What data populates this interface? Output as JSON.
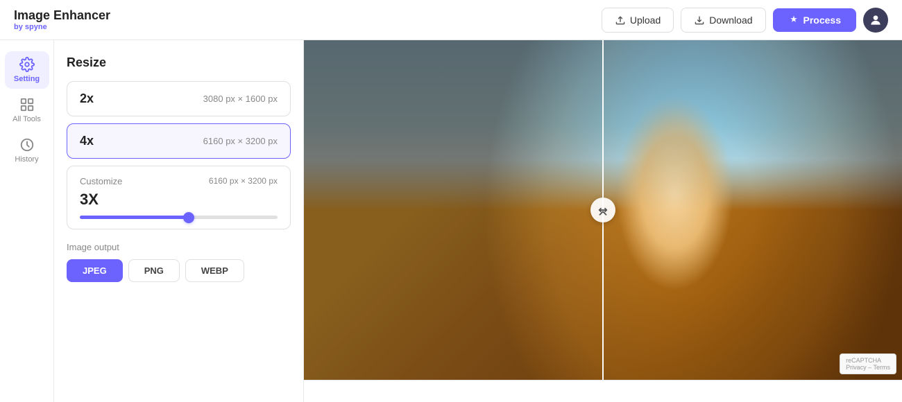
{
  "header": {
    "logo_title": "Image Enhancer",
    "logo_sub_prefix": "by ",
    "logo_sub_brand": "spyne",
    "upload_label": "Upload",
    "download_label": "Download",
    "process_label": "Process"
  },
  "sidebar": {
    "items": [
      {
        "id": "setting",
        "label": "Setting",
        "active": true
      },
      {
        "id": "all-tools",
        "label": "All Tools",
        "active": false
      },
      {
        "id": "history",
        "label": "History",
        "active": false
      }
    ]
  },
  "panel": {
    "title": "Resize",
    "options": [
      {
        "label": "2x",
        "dims": "3080 px × 1600 px",
        "selected": false
      },
      {
        "label": "4x",
        "dims": "6160 px × 3200 px",
        "selected": true
      }
    ],
    "customize": {
      "title": "Customize",
      "value": "3X",
      "dims": "6160 px × 3200 px",
      "slider_percent": 55
    },
    "output_label": "Image output",
    "formats": [
      {
        "label": "JPEG",
        "active": true
      },
      {
        "label": "PNG",
        "active": false
      },
      {
        "label": "WEBP",
        "active": false
      }
    ]
  },
  "icons": {
    "upload": "↑",
    "download": "↓",
    "process": "✦",
    "setting": "⚙",
    "all_tools": "⊞",
    "history": "⏱",
    "arrow_left": "◂",
    "arrow_right": "▸"
  }
}
